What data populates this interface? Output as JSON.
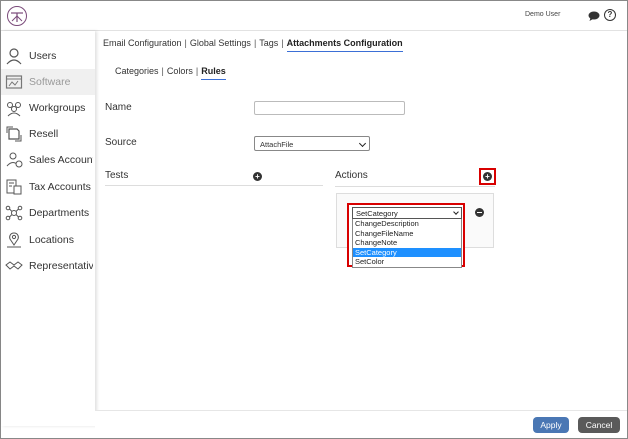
{
  "header": {
    "user_name": "Demo User",
    "chat_icon": "chat-icon",
    "help_icon_glyph": "?"
  },
  "sidebar": {
    "items": [
      {
        "label": "Users",
        "icon": "user-icon",
        "active": false
      },
      {
        "label": "Software",
        "icon": "software-icon",
        "active": true
      },
      {
        "label": "Workgroups",
        "icon": "workgroups-icon",
        "active": false
      },
      {
        "label": "Resell",
        "icon": "resell-icon",
        "active": false
      },
      {
        "label": "Sales Accounts",
        "icon": "sales-accounts-icon",
        "active": false
      },
      {
        "label": "Tax Accounts",
        "icon": "tax-accounts-icon",
        "active": false
      },
      {
        "label": "Departments",
        "icon": "departments-icon",
        "active": false
      },
      {
        "label": "Locations",
        "icon": "locations-icon",
        "active": false
      },
      {
        "label": "Representatives",
        "icon": "representatives-icon",
        "active": false
      }
    ]
  },
  "tabs": [
    {
      "label": "Email Configuration",
      "active": false
    },
    {
      "label": "Global Settings",
      "active": false
    },
    {
      "label": "Tags",
      "active": false
    },
    {
      "label": "Attachments Configuration",
      "active": true
    }
  ],
  "subtabs": [
    {
      "label": "Categories",
      "active": false
    },
    {
      "label": "Colors",
      "active": false
    },
    {
      "label": "Rules",
      "active": true
    }
  ],
  "form": {
    "name_label": "Name",
    "name_value": "",
    "source_label": "Source",
    "source_value": "AttachFile",
    "tests_label": "Tests",
    "actions_label": "Actions",
    "action_select_value": "SetCategory",
    "action_options": [
      "ChangeDescription",
      "ChangeFileName",
      "ChangeNote",
      "SetCategory",
      "SetColor"
    ],
    "selected_option": "SetCategory"
  },
  "footer": {
    "apply_label": "Apply",
    "cancel_label": "Cancel"
  },
  "colors": {
    "highlight_border": "#d80000",
    "apply_button": "#4a77b4",
    "cancel_button": "#5a5a5a",
    "tab_underline": "#3b6fd6",
    "selected_option": "#1e90ff"
  }
}
